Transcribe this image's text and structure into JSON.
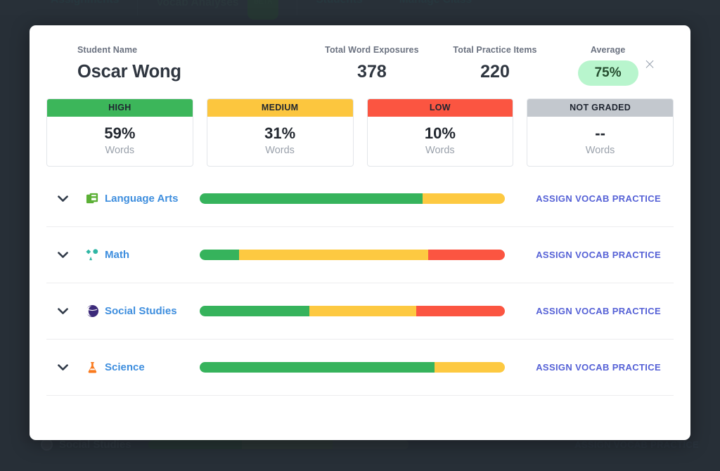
{
  "background": {
    "tabs": [
      {
        "label": "Assignments",
        "pill": ""
      },
      {
        "label": "Vocab Analyses",
        "pill": "BETA"
      },
      {
        "label": "Students",
        "pill": ""
      },
      {
        "label": "Manage Class",
        "pill": ""
      }
    ],
    "row": {
      "label": "Social Studies",
      "link": "ASSIGN VOCAB PRACTICE",
      "segments": [
        {
          "name": "high",
          "pct": 36,
          "color": "#2b4237"
        },
        {
          "name": "medium",
          "pct": 35,
          "color": "#36433a"
        },
        {
          "name": "low",
          "pct": 29,
          "color": "#353f44"
        }
      ]
    }
  },
  "modal": {
    "close_label": "×",
    "header": {
      "student_name_label": "Student Name",
      "student_name": "Oscar Wong",
      "total_word_exposures_label": "Total Word Exposures",
      "total_word_exposures": "378",
      "total_practice_items_label": "Total Practice Items",
      "total_practice_items": "220",
      "average_label": "Average",
      "average": "75%",
      "average_bg": "#b8f5cd"
    },
    "cards": [
      {
        "title": "HIGH",
        "value": "59%",
        "unit": "Words",
        "color": "#3cb65a"
      },
      {
        "title": "MEDIUM",
        "value": "31%",
        "unit": "Words",
        "color": "#fcc63e"
      },
      {
        "title": "LOW",
        "value": "10%",
        "unit": "Words",
        "color": "#fb5541"
      },
      {
        "title": "NOT GRADED",
        "value": "--",
        "unit": "Words",
        "color": "#c3c8ce"
      }
    ],
    "assign_link_label": "ASSIGN VOCAB PRACTICE",
    "subjects": [
      {
        "name": "Language Arts",
        "icon": "books-icon",
        "icon_color": "#5cb036",
        "segments": [
          {
            "level": "high",
            "pct": 73,
            "color": "#36b35c"
          },
          {
            "level": "medium",
            "pct": 27,
            "color": "#fdc941"
          }
        ]
      },
      {
        "name": "Math",
        "icon": "shapes-icon",
        "icon_color": "#2fb6a4",
        "segments": [
          {
            "level": "high",
            "pct": 13,
            "color": "#36b35c"
          },
          {
            "level": "medium",
            "pct": 62,
            "color": "#fdc941"
          },
          {
            "level": "low",
            "pct": 25,
            "color": "#fb5541"
          }
        ]
      },
      {
        "name": "Social Studies",
        "icon": "globe-icon",
        "icon_color": "#3c2a7a",
        "segments": [
          {
            "level": "high",
            "pct": 36,
            "color": "#36b35c"
          },
          {
            "level": "medium",
            "pct": 35,
            "color": "#fdc941"
          },
          {
            "level": "low",
            "pct": 29,
            "color": "#fb5541"
          }
        ]
      },
      {
        "name": "Science",
        "icon": "flask-icon",
        "icon_color": "#fa7a1e",
        "segments": [
          {
            "level": "high",
            "pct": 77,
            "color": "#36b35c"
          },
          {
            "level": "medium",
            "pct": 23,
            "color": "#fdc941"
          }
        ]
      }
    ]
  }
}
